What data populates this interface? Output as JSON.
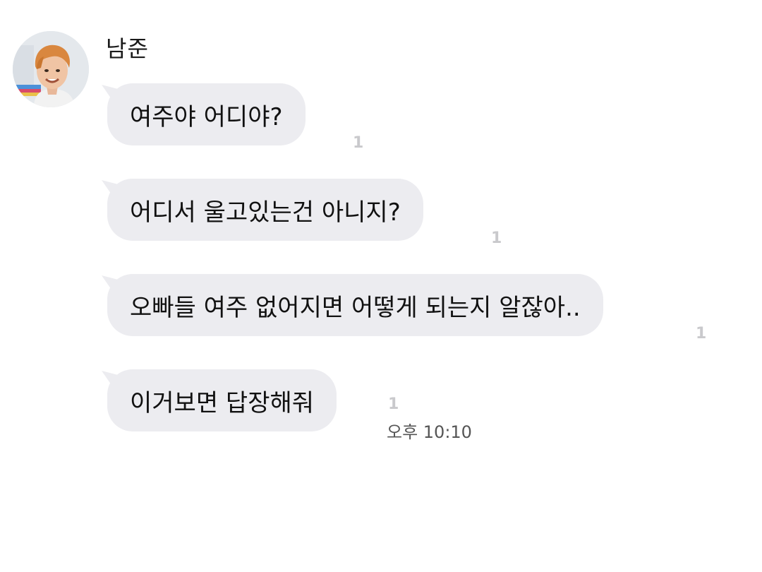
{
  "chat": {
    "sender_name": "남준",
    "messages": [
      {
        "text": "여주야 어디야?",
        "read_count": "1"
      },
      {
        "text": "어디서 울고있는건 아니지?",
        "read_count": "1"
      },
      {
        "text": "오빠들 여주 없어지면 어떻게 되는지 알잖아..",
        "read_count": "1"
      },
      {
        "text": "이거보면 답장해줘",
        "read_count": "1"
      }
    ],
    "time": "오후 10:10"
  },
  "colors": {
    "bubble": "#ececf0",
    "read_count": "#c9c9cc",
    "text": "#111111"
  }
}
